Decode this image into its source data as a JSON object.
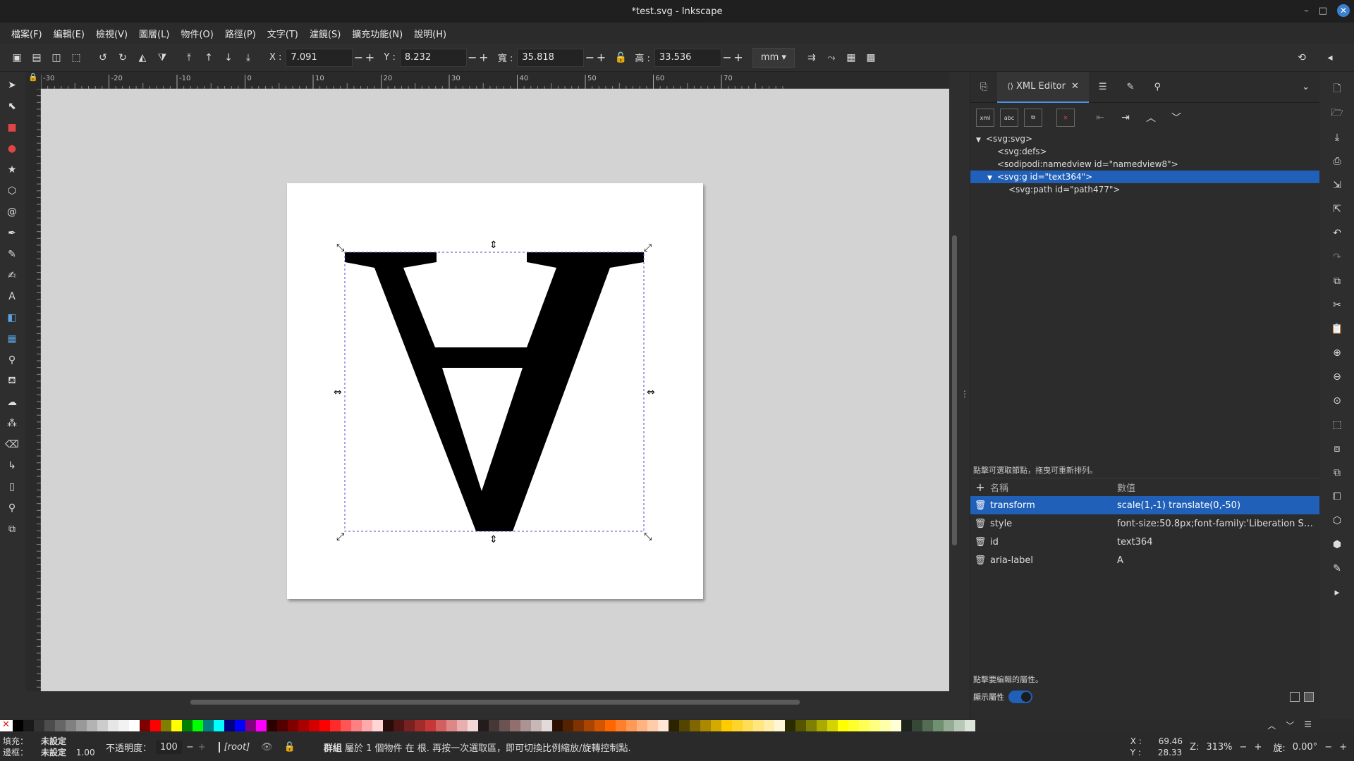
{
  "window": {
    "title": "*test.svg - Inkscape",
    "minimize": "–",
    "maximize": "□",
    "close": "✕"
  },
  "menu": [
    "檔案(F)",
    "編輯(E)",
    "檢視(V)",
    "圖層(L)",
    "物件(O)",
    "路徑(P)",
    "文字(T)",
    "濾鏡(S)",
    "擴充功能(N)",
    "說明(H)"
  ],
  "toolbar": {
    "x_label": "X :",
    "x_value": "7.091",
    "y_label": "Y :",
    "y_value": "8.232",
    "w_label": "寬 :",
    "w_value": "35.818",
    "h_label": "高 :",
    "h_value": "33.536",
    "unit": "mm"
  },
  "ruler_top": [
    "-30",
    "-20",
    "-10",
    "0",
    "10",
    "20",
    "30",
    "40",
    "50",
    "60",
    "70"
  ],
  "panel": {
    "tab_label": "XML Editor",
    "tree": [
      {
        "text": "<svg:svg>",
        "indent": 0,
        "arrow": "▼",
        "selected": false
      },
      {
        "text": "<svg:defs>",
        "indent": 1,
        "arrow": "",
        "selected": false
      },
      {
        "text": "<sodipodi:namedview id=\"namedview8\">",
        "indent": 1,
        "arrow": "",
        "selected": false
      },
      {
        "text": "<svg:g id=\"text364\">",
        "indent": 1,
        "arrow": "▼",
        "selected": true
      },
      {
        "text": "<svg:path id=\"path477\">",
        "indent": 2,
        "arrow": "",
        "selected": false
      }
    ],
    "tree_hint": "點擊可選取節點，拖曳可重新排列。",
    "attr_col_name": "名稱",
    "attr_col_value": "數值",
    "attributes": [
      {
        "name": "transform",
        "value": "scale(1,-1) translate(0,-50)",
        "selected": true
      },
      {
        "name": "style",
        "value": "font-size:50.8px;font-family:'Liberation Serif…",
        "selected": false
      },
      {
        "name": "id",
        "value": "text364",
        "selected": false
      },
      {
        "name": "aria-label",
        "value": "A",
        "selected": false
      }
    ],
    "attr_hint": "點擊要編輯的屬性。",
    "show_attr_label": "顯示屬性"
  },
  "status": {
    "fill_label": "填充：",
    "fill_value": "未設定",
    "stroke_label": "邊框：",
    "stroke_value": "未設定",
    "stroke_width": "1.00",
    "opacity_label": "不透明度：",
    "opacity_value": "100",
    "layer": "[root]",
    "message_bold": "群組",
    "message": " 屬於 1 個物件 在 根. 再按一次選取區，即可切換比例縮放/旋轉控制點.",
    "x_label": "X :",
    "x_value": "69.46",
    "y_label": "Y :",
    "y_value": "28.33",
    "zoom_label": "Z:",
    "zoom_value": "313%",
    "rotation_label": "旋:",
    "rotation_value": "0.00°"
  },
  "colors": {
    "accent": "#2160b8",
    "palette": [
      "#000000",
      "#1a1a1a",
      "#333333",
      "#4d4d4d",
      "#666666",
      "#808080",
      "#999999",
      "#b3b3b3",
      "#cccccc",
      "#e6e6e6",
      "#f2f2f2",
      "#ffffff",
      "#800000",
      "#ff0000",
      "#808000",
      "#ffff00",
      "#008000",
      "#00ff00",
      "#008080",
      "#00ffff",
      "#000080",
      "#0000ff",
      "#800080",
      "#ff00ff",
      "#2b0000",
      "#550000",
      "#800000",
      "#aa0000",
      "#d40000",
      "#ff0000",
      "#ff2a2a",
      "#ff5555",
      "#ff8080",
      "#ffaaaa",
      "#ffd5d5",
      "#280b0b",
      "#501616",
      "#782121",
      "#a02c2c",
      "#c83737",
      "#d35f5f",
      "#de8787",
      "#e9afaf",
      "#f4d7d7",
      "#241c1c",
      "#483737",
      "#6c5353",
      "#916f6f",
      "#ac9393",
      "#c8b7b7",
      "#e3dbdb",
      "#2b1100",
      "#552200",
      "#803300",
      "#aa4400",
      "#d45500",
      "#ff6600",
      "#ff7f2a",
      "#ff9955",
      "#ffb380",
      "#ffccaa",
      "#ffe6d5",
      "#2b2200",
      "#554400",
      "#806600",
      "#aa8800",
      "#d4aa00",
      "#ffcc00",
      "#ffd42a",
      "#ffdd55",
      "#ffe680",
      "#ffeeaa",
      "#fff6d5",
      "#2b2b00",
      "#555500",
      "#808000",
      "#aaaa00",
      "#d4d400",
      "#ffff00",
      "#ffff2a",
      "#ffff55",
      "#ffff80",
      "#ffffaa",
      "#ffffd5",
      "#1c241c",
      "#374837",
      "#536c53",
      "#6f916f",
      "#93ac93",
      "#b7c8b7",
      "#dbe3db"
    ]
  }
}
